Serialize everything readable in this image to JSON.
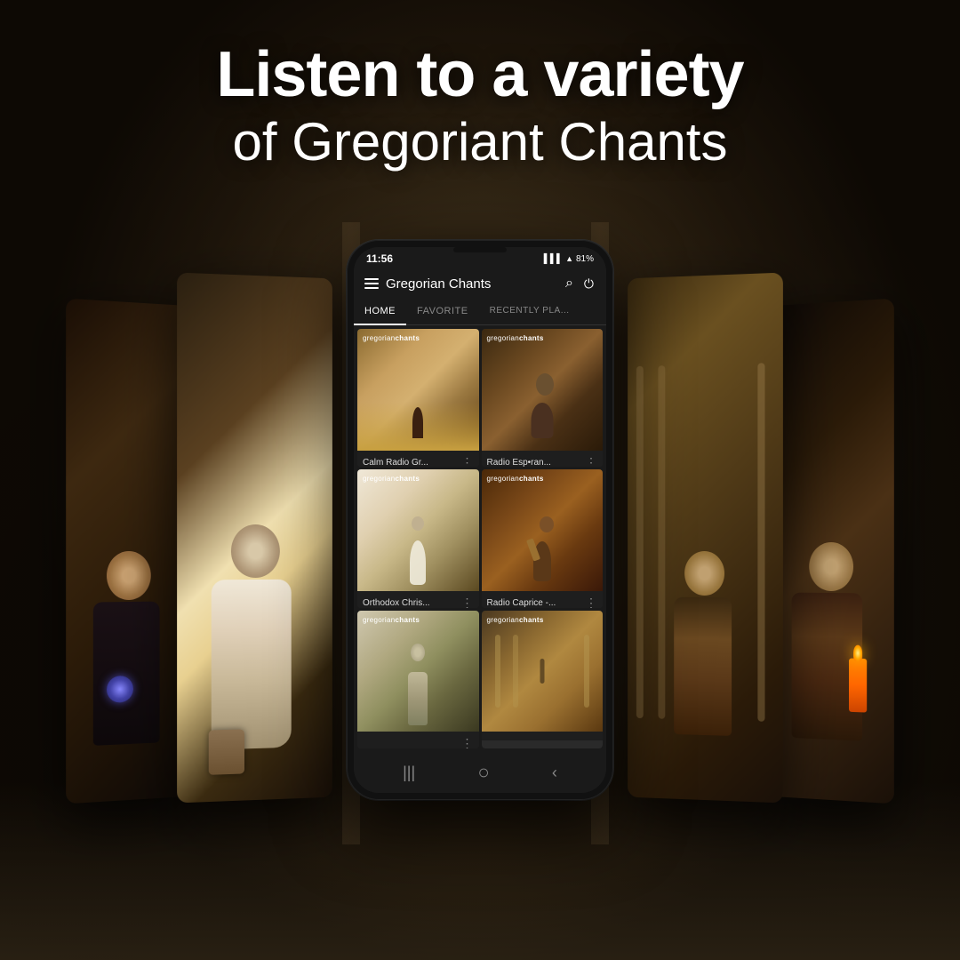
{
  "hero": {
    "line1": "Listen to a variety",
    "line2": "of Gregoriant Chants"
  },
  "phone": {
    "status_bar": {
      "time": "11:56",
      "battery": "81%",
      "signal": "▌▌▌"
    },
    "header": {
      "title": "Gregorian Chants",
      "menu_icon": "≡",
      "search_icon": "⌕",
      "power_icon": "⏻"
    },
    "nav_tabs": [
      {
        "label": "HOME",
        "active": true
      },
      {
        "label": "FAVORITE",
        "active": false
      },
      {
        "label": "RECENTLY PLA...",
        "active": false
      }
    ],
    "music_cards": [
      {
        "id": 1,
        "name": "Calm Radio Gr...",
        "thumb_class": "thumb-1",
        "thumb_label_regular": "gregorian",
        "thumb_label_bold": "chants"
      },
      {
        "id": 2,
        "name": "Radio Esp•ran...",
        "thumb_class": "thumb-2",
        "thumb_label_regular": "gregorian",
        "thumb_label_bold": "chants"
      },
      {
        "id": 3,
        "name": "Orthodox Chris...",
        "thumb_class": "thumb-3",
        "thumb_label_regular": "gregorian",
        "thumb_label_bold": "chants"
      },
      {
        "id": 4,
        "name": "Radio Caprice -...",
        "thumb_class": "thumb-4",
        "thumb_label_regular": "gregorian",
        "thumb_label_bold": "chants"
      },
      {
        "id": 5,
        "name": "",
        "thumb_class": "thumb-5",
        "thumb_label_regular": "gregorian",
        "thumb_label_bold": "chants"
      },
      {
        "id": 6,
        "name": "",
        "thumb_class": "thumb-6",
        "thumb_label_regular": "gregorian",
        "thumb_label_bold": "chants"
      }
    ],
    "bottom_bar": {
      "icons": [
        "|||",
        "○",
        "‹"
      ]
    }
  },
  "colors": {
    "background": "#2d1e0a",
    "phone_bg": "#1a1a1a",
    "accent": "#ffffff",
    "tab_active": "#ffffff",
    "tab_inactive": "#888888"
  }
}
